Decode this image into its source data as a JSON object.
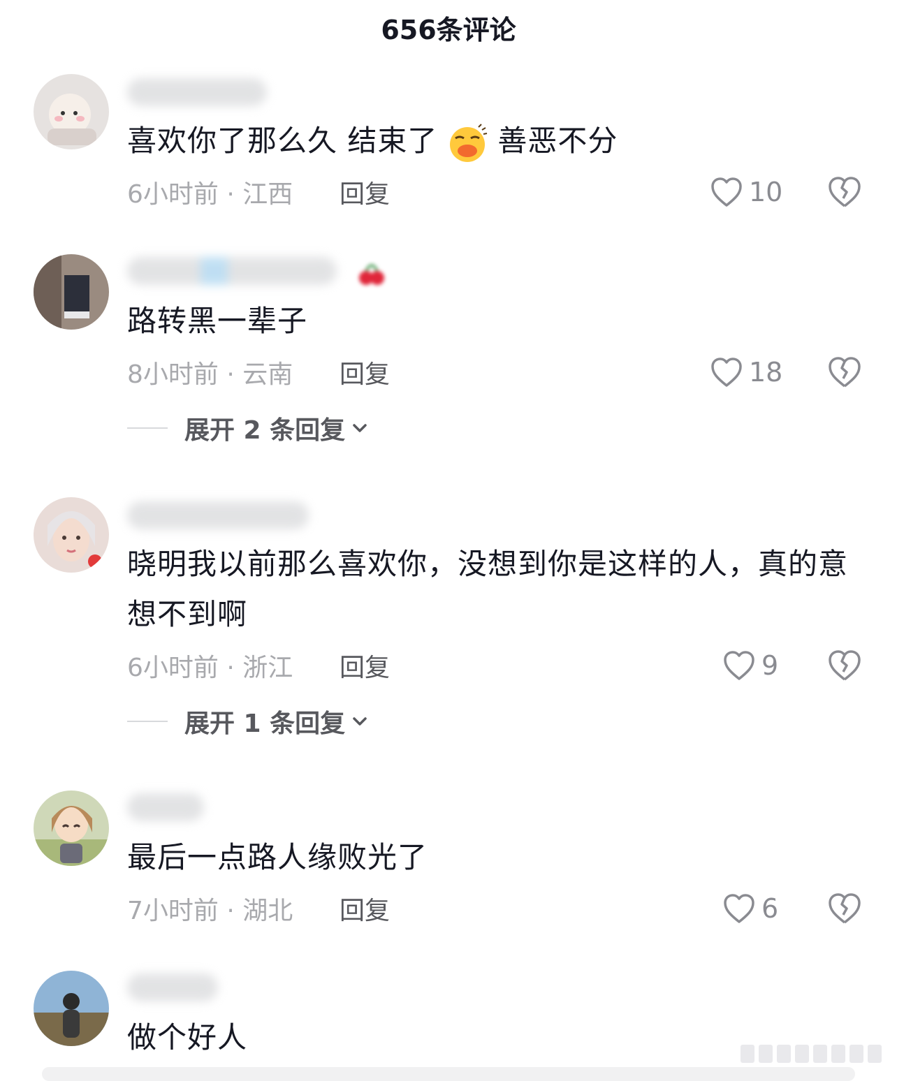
{
  "header": {
    "title": "656条评论"
  },
  "comments": [
    {
      "text_before": "喜欢你了那么久 结束了",
      "text_after": "善恶不分",
      "emoji": "laughing-face-emoji",
      "time": "6小时前 · 江西",
      "reply": "回复",
      "likes": "10"
    },
    {
      "text": "路转黑一辈子",
      "time": "8小时前 · 云南",
      "reply": "回复",
      "likes": "18",
      "expand": "展开 2 条回复"
    },
    {
      "text": "晓明我以前那么喜欢你，没想到你是这样的人，真的意想不到啊",
      "time": "6小时前 · 浙江",
      "reply": "回复",
      "likes": "9",
      "expand": "展开 1 条回复"
    },
    {
      "text": "最后一点路人缘败光了",
      "time": "7小时前 · 湖北",
      "reply": "回复",
      "likes": "6"
    },
    {
      "text": "做个好人"
    }
  ],
  "icons": {
    "like": "heart-outline-icon",
    "dislike": "broken-heart-icon",
    "expand": "chevron-down-icon"
  },
  "colors": {
    "text": "#161823",
    "meta": "#a8a9ad",
    "reply": "#57585d"
  }
}
